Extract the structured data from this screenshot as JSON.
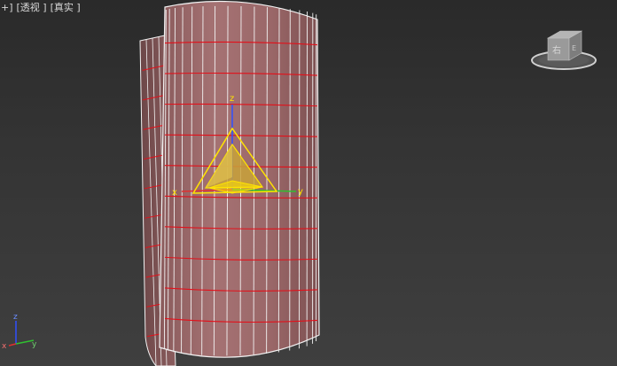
{
  "viewport": {
    "menu": {
      "plus": "+]",
      "view": "[透视 ]",
      "shading": "[真实 ]"
    }
  },
  "viewcube": {
    "face_label": "右",
    "face_label_2": "E"
  },
  "gizmo": {
    "x_label": "x",
    "y_label": "y",
    "z_label": "z"
  },
  "axis_tripod": {
    "x_label": "x",
    "y_label": "y",
    "z_label": "z"
  },
  "colors": {
    "surface": "#9c6a6b",
    "grid_white": "#f2f2f2",
    "grid_red": "#e3101a",
    "gizmo_yellow": "#ffe400",
    "gizmo_fill": "#c8a23a",
    "axis_x": "#e03030",
    "axis_y": "#30c030",
    "axis_z": "#3050ff"
  }
}
